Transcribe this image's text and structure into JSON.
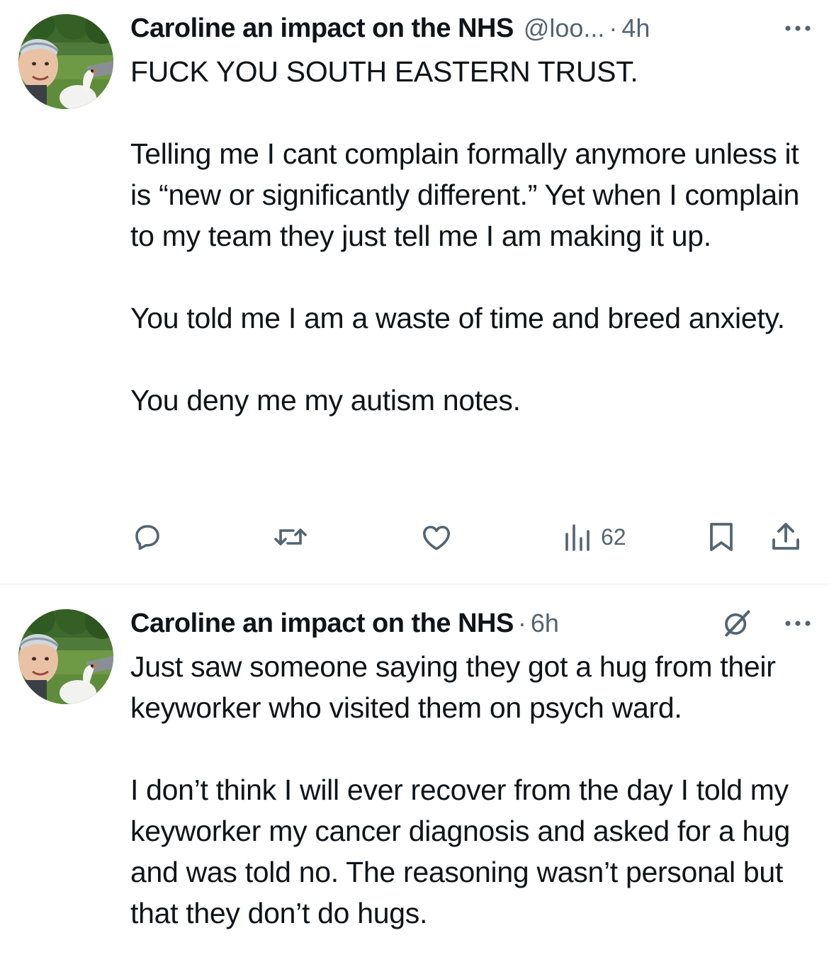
{
  "tweets": [
    {
      "display_name": "Caroline an impact on the NHS",
      "handle": "@loo...",
      "separator": "·",
      "time": "4h",
      "paragraphs": [
        "FUCK YOU SOUTH EASTERN TRUST.",
        "Telling me I cant complain formally anymore unless it is “new or significantly different.”  Yet when I complain to my team they just tell me I am making it up.",
        "You told me I am a waste of time and breed anxiety.",
        "You deny me my autism notes."
      ],
      "actions": {
        "reply_icon": "reply-icon",
        "retweet_icon": "retweet-icon",
        "like_icon": "like-icon",
        "views_icon": "views-icon",
        "views_count": "62",
        "bookmark_icon": "bookmark-icon",
        "share_icon": "share-icon"
      }
    },
    {
      "display_name": "Caroline an impact on the NHS",
      "separator": "·",
      "time": "6h",
      "paragraphs": [
        "Just saw someone saying they got a hug from their keyworker who visited them on psych ward.",
        "I don’t think I will ever recover from the day I told my keyworker my cancer diagnosis and asked for a hug and was told no.  The reasoning wasn’t personal but that they don’t do hugs."
      ],
      "header_icons": [
        "grok-icon",
        "more-icon"
      ]
    }
  ],
  "colors": {
    "text_primary": "#0f1419",
    "text_secondary": "#536471",
    "divider": "#e6e9ec"
  }
}
